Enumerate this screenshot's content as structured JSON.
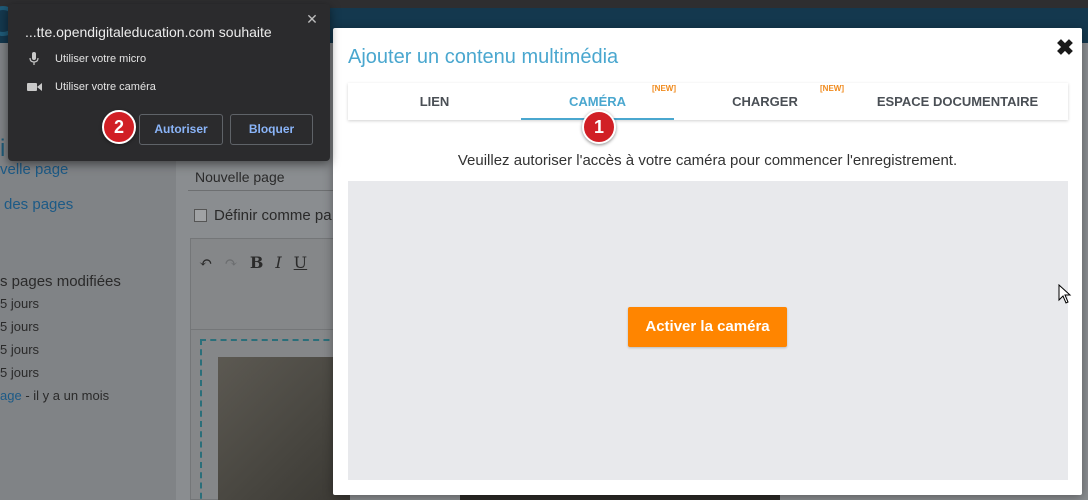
{
  "background": {
    "sidebar_links": [
      "velle page",
      "des pages"
    ],
    "recent_title": "s pages modifiées",
    "recent_items": [
      "5 jours",
      "5 jours",
      "5 jours",
      "5 jours"
    ],
    "recent_last_link": "age",
    "recent_last_time": " - il y a un mois",
    "page_title_input": "Nouvelle page",
    "checkbox_label": "Définir comme pa",
    "toolbar": {
      "bold": "B",
      "italic": "I",
      "underline": "U"
    }
  },
  "permission_popup": {
    "title": "...tte.opendigitaleducation.com souhaite",
    "close": "✕",
    "mic_label": "Utiliser votre micro",
    "camera_label": "Utiliser votre caméra",
    "allow_label": "Autoriser",
    "block_label": "Bloquer",
    "accent_color": "#8ab4f8"
  },
  "modal": {
    "title": "Ajouter un contenu multimédia",
    "close": "✖",
    "tabs": [
      {
        "label": "LIEN",
        "badge": ""
      },
      {
        "label": "CAMÉRA",
        "badge": "[NEW]",
        "active": true
      },
      {
        "label": "CHARGER",
        "badge": "[NEW]"
      },
      {
        "label": "ESPACE DOCUMENTAIRE",
        "badge": ""
      }
    ],
    "notice": "Veuillez autoriser l'accès à votre caméra pour commencer l'enregistrement.",
    "activate_button": "Activer la caméra",
    "accent_color": "#4aa7cf",
    "button_color": "#ff8500"
  },
  "markers": [
    "1",
    "2"
  ]
}
